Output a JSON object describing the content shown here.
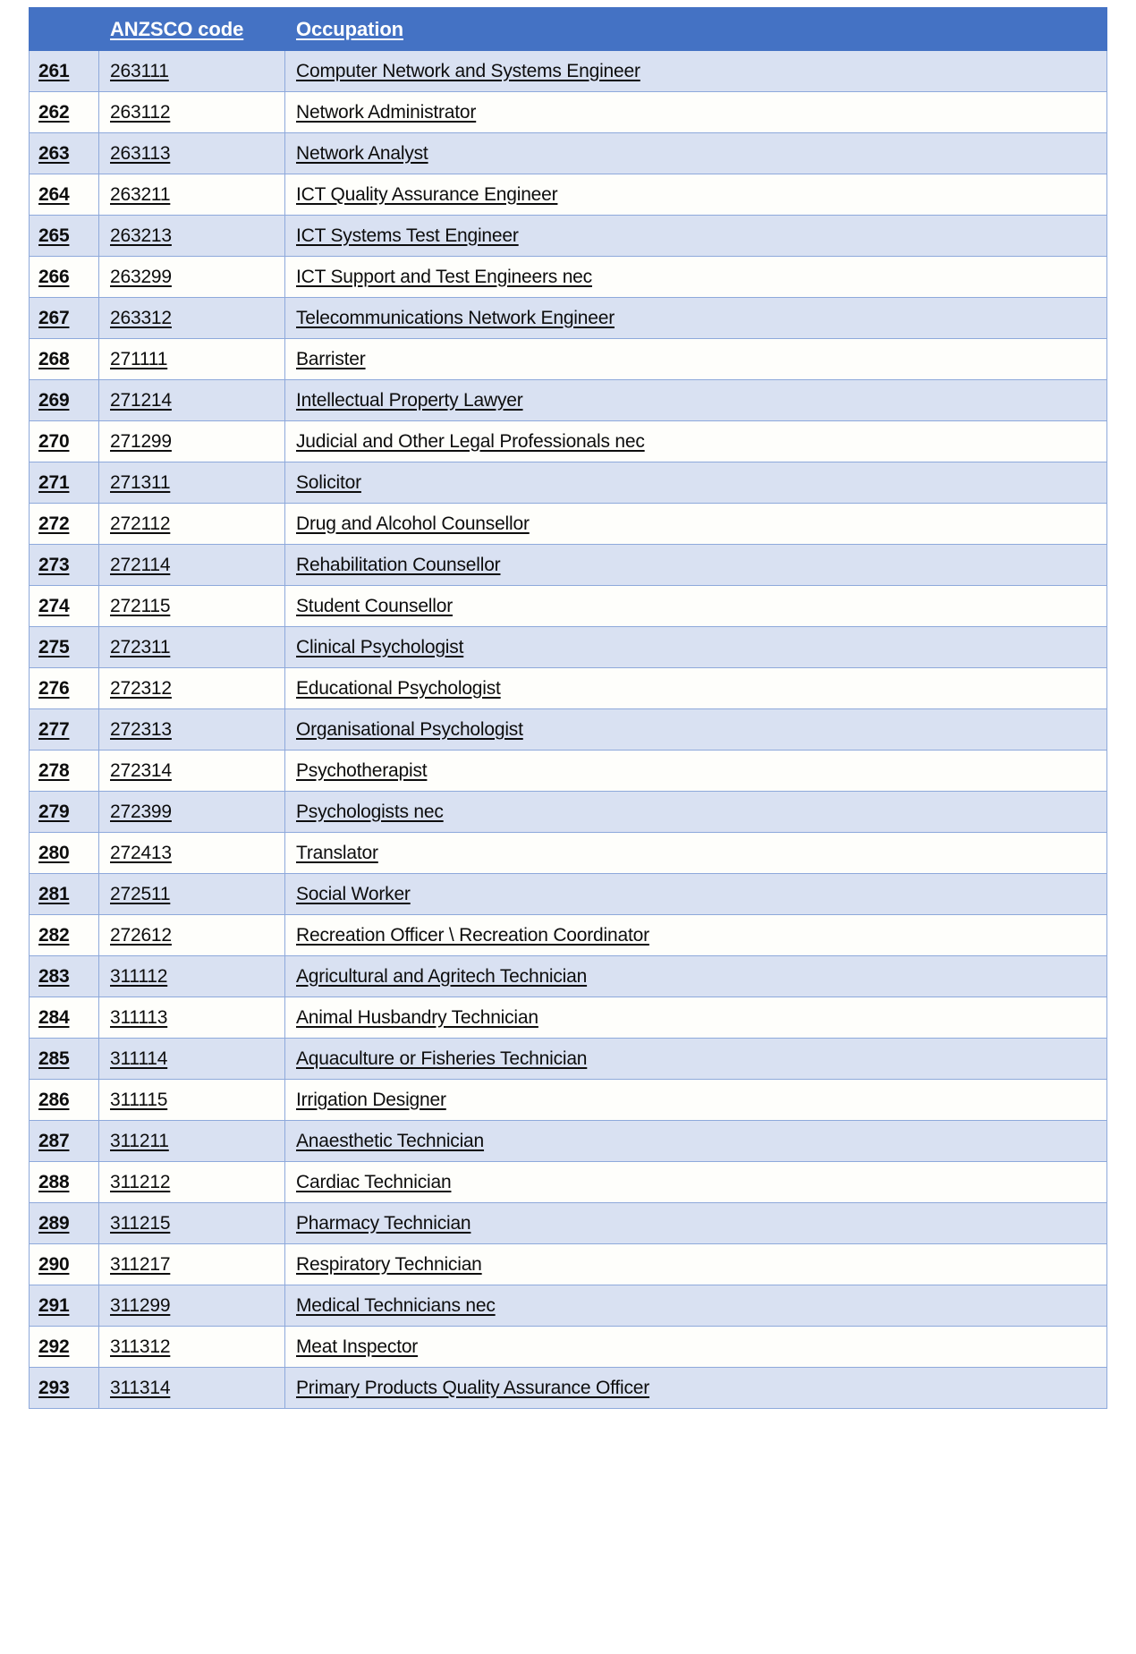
{
  "document": {
    "type": "occupation-list-table",
    "colors": {
      "header_background": "#4472C4",
      "header_text": "#FFFFFF",
      "row_band_shaded": "#D9E1F2",
      "row_band_plain": "#FEFEFB",
      "cell_border": "#8EA9DB",
      "body_text": "#0D0D0D"
    }
  },
  "table": {
    "headers": {
      "index": "",
      "code": "ANZSCO code",
      "occupation": "Occupation"
    },
    "rows": [
      {
        "index": "261",
        "code": "263111",
        "occupation": "Computer Network and Systems Engineer"
      },
      {
        "index": "262",
        "code": "263112",
        "occupation": "Network Administrator"
      },
      {
        "index": "263",
        "code": "263113",
        "occupation": "Network Analyst"
      },
      {
        "index": "264",
        "code": "263211",
        "occupation": "ICT Quality Assurance Engineer"
      },
      {
        "index": "265",
        "code": "263213",
        "occupation": "ICT Systems Test Engineer"
      },
      {
        "index": "266",
        "code": "263299",
        "occupation": "ICT Support and Test Engineers nec"
      },
      {
        "index": "267",
        "code": "263312",
        "occupation": "Telecommunications Network Engineer"
      },
      {
        "index": "268",
        "code": "271111",
        "occupation": "Barrister"
      },
      {
        "index": "269",
        "code": "271214",
        "occupation": "Intellectual Property Lawyer"
      },
      {
        "index": "270",
        "code": "271299",
        "occupation": "Judicial and Other Legal Professionals nec"
      },
      {
        "index": "271",
        "code": "271311",
        "occupation": "Solicitor"
      },
      {
        "index": "272",
        "code": "272112",
        "occupation": "Drug and Alcohol Counsellor"
      },
      {
        "index": "273",
        "code": "272114",
        "occupation": "Rehabilitation Counsellor"
      },
      {
        "index": "274",
        "code": "272115",
        "occupation": "Student Counsellor"
      },
      {
        "index": "275",
        "code": "272311",
        "occupation": "Clinical Psychologist"
      },
      {
        "index": "276",
        "code": "272312",
        "occupation": "Educational Psychologist"
      },
      {
        "index": "277",
        "code": "272313",
        "occupation": "Organisational Psychologist"
      },
      {
        "index": "278",
        "code": "272314",
        "occupation": "Psychotherapist"
      },
      {
        "index": "279",
        "code": "272399",
        "occupation": "Psychologists nec"
      },
      {
        "index": "280",
        "code": "272413",
        "occupation": "Translator"
      },
      {
        "index": "281",
        "code": "272511",
        "occupation": "Social Worker"
      },
      {
        "index": "282",
        "code": "272612",
        "occupation": "Recreation Officer \\ Recreation Coordinator"
      },
      {
        "index": "283",
        "code": "311112",
        "occupation": "Agricultural and Agritech Technician"
      },
      {
        "index": "284",
        "code": "311113",
        "occupation": "Animal Husbandry Technician"
      },
      {
        "index": "285",
        "code": "311114",
        "occupation": "Aquaculture or Fisheries Technician"
      },
      {
        "index": "286",
        "code": "311115",
        "occupation": "Irrigation Designer"
      },
      {
        "index": "287",
        "code": "311211",
        "occupation": "Anaesthetic Technician"
      },
      {
        "index": "288",
        "code": "311212",
        "occupation": "Cardiac Technician"
      },
      {
        "index": "289",
        "code": "311215",
        "occupation": "Pharmacy Technician"
      },
      {
        "index": "290",
        "code": "311217",
        "occupation": "Respiratory Technician"
      },
      {
        "index": "291",
        "code": "311299",
        "occupation": "Medical Technicians nec"
      },
      {
        "index": "292",
        "code": "311312",
        "occupation": "Meat Inspector"
      },
      {
        "index": "293",
        "code": "311314",
        "occupation": "Primary Products Quality Assurance Officer"
      }
    ]
  }
}
